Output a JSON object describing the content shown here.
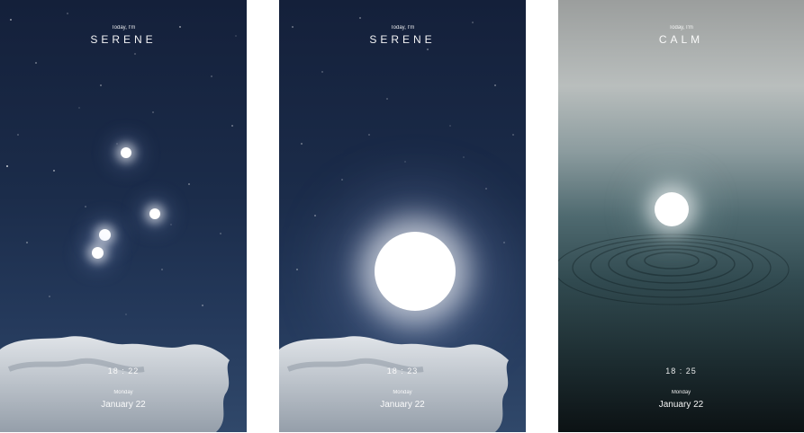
{
  "screens": [
    {
      "label_top": "Today, I'm",
      "mood": "SERENE",
      "time": "18 : 22",
      "day": "Monday",
      "date": "January 22",
      "background": "night-sky"
    },
    {
      "label_top": "Today, I'm",
      "mood": "SERENE",
      "time": "18 : 23",
      "day": "Monday",
      "date": "January 22",
      "background": "night-sky"
    },
    {
      "label_top": "Today, I'm",
      "mood": "CALM",
      "time": "18 : 25",
      "day": "Monday",
      "date": "January 22",
      "background": "calm-water"
    }
  ],
  "colors": {
    "night_top": "#14203a",
    "night_bottom": "#30486a",
    "water_light": "#b9bebd",
    "water_dark": "#0c1214",
    "orb": "#ffffff"
  }
}
